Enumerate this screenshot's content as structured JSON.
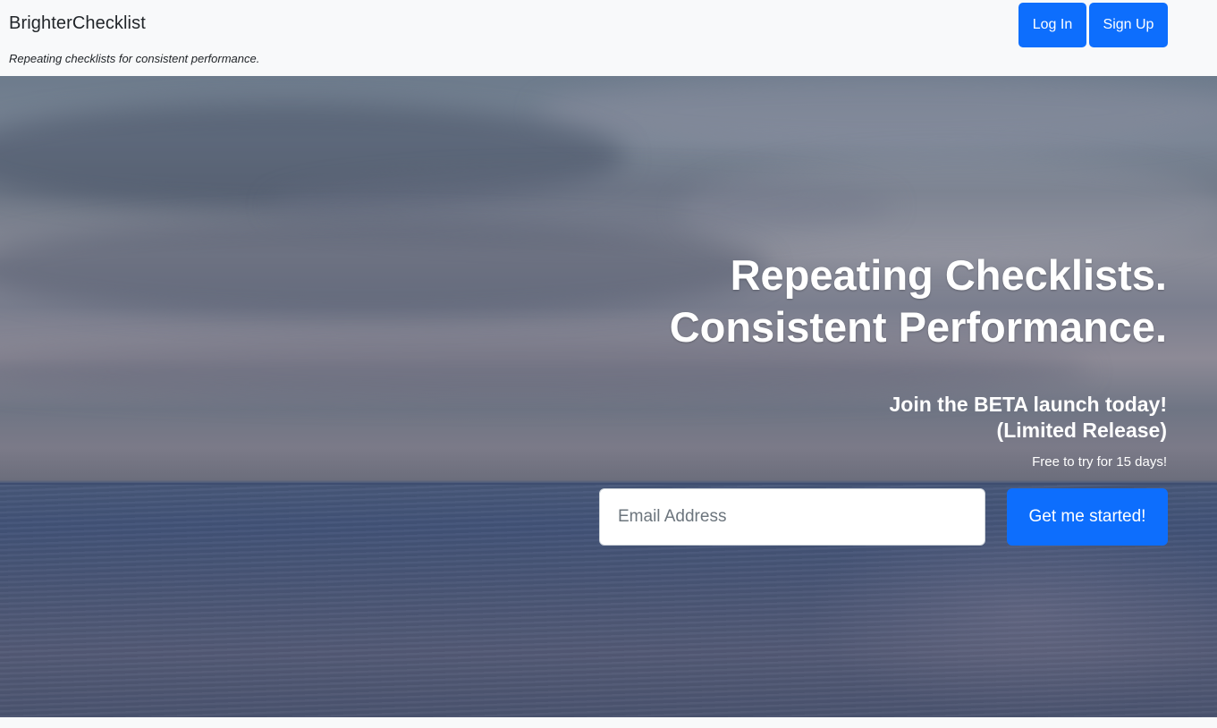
{
  "navbar": {
    "brand": "BrighterChecklist",
    "tagline": "Repeating checklists for consistent performance.",
    "login_label": "Log In",
    "signup_label": "Sign Up"
  },
  "hero": {
    "headline_line1": "Repeating Checklists.",
    "headline_line2": "Consistent Performance.",
    "subhead_line1": "Join the BETA launch today!",
    "subhead_line2": "(Limited Release)",
    "trial_note": "Free to try for 15 days!",
    "email_placeholder": "Email Address",
    "email_value": "",
    "cta_label": "Get me started!"
  },
  "colors": {
    "primary": "#0d6efd",
    "navbar_bg": "#f8f9fa",
    "text_dark": "#212529"
  }
}
